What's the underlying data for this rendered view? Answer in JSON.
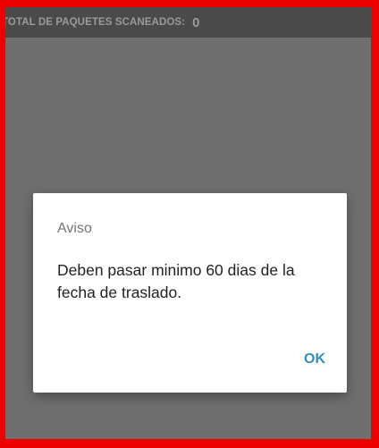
{
  "topbar": {
    "label": "TOTAL DE PAQUETES SCANEADOS:",
    "count": "0"
  },
  "dialog": {
    "title": "Aviso",
    "message": "Deben pasar minimo 60 dias de la fecha de traslado.",
    "ok_label": "OK"
  },
  "colors": {
    "frame": "#ee0000",
    "overlay": "#6f6f6f",
    "topbar": "#4a4a4a",
    "accent": "#2c8fc7"
  }
}
